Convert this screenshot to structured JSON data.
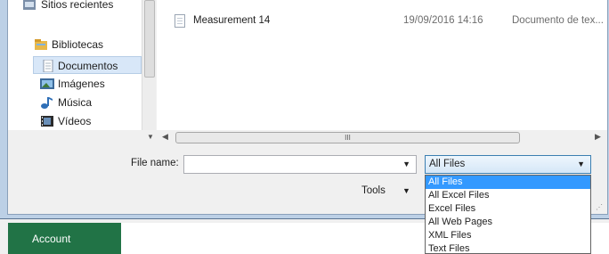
{
  "nav": {
    "items": [
      {
        "label": "Sitios recientes",
        "icon": "recent-places-icon"
      },
      {
        "label": "Bibliotecas",
        "icon": "libraries-icon"
      },
      {
        "label": "Documentos",
        "icon": "documents-icon"
      },
      {
        "label": "Imágenes",
        "icon": "pictures-icon"
      },
      {
        "label": "Música",
        "icon": "music-icon"
      },
      {
        "label": "Vídeos",
        "icon": "videos-icon"
      }
    ]
  },
  "files": {
    "rows": [
      {
        "name": "Measurement 14",
        "date": "19/09/2016 14:16",
        "type": "Documento de tex..."
      }
    ]
  },
  "hscroll": {
    "thumb_grip": "III"
  },
  "filename": {
    "label": "File name:",
    "value": ""
  },
  "filter": {
    "selected": "All Files",
    "options": [
      "All Files",
      "All Excel Files",
      "Excel Files",
      "All Web Pages",
      "XML Files",
      "Text Files"
    ]
  },
  "tools": {
    "label": "Tools"
  },
  "background_app": {
    "account_label": "Account",
    "accent": "#217346"
  }
}
